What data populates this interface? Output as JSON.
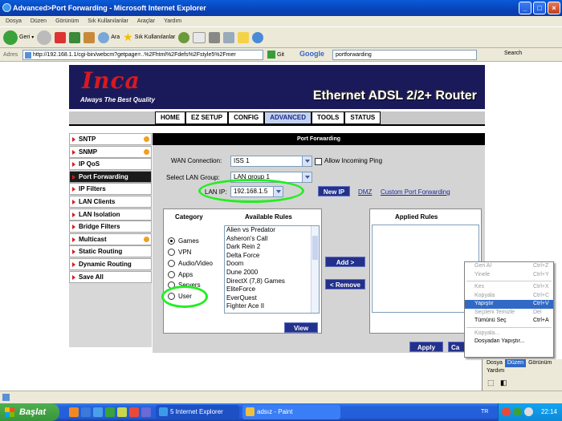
{
  "window": {
    "title": "Advanced>Port Forwarding - Microsoft Internet Explorer"
  },
  "menubar": [
    "Dosya",
    "Düzen",
    "Görünüm",
    "Sık Kullanılanlar",
    "Araçlar",
    "Yardım"
  ],
  "toolbar": {
    "back": "Geri",
    "search": "Ara",
    "favorites": "Sık Kullanılanlar"
  },
  "address": {
    "label": "Adres",
    "url": "http://192.168.1.1/cgi-bin/webcm?getpage=..%2Fhtml%2Fdefs%2Fstyle5%2Fmer",
    "go": "Git",
    "google": "Google",
    "search_value": "portforwarding",
    "search_label": "Search"
  },
  "banner": {
    "logo": "Inca",
    "tagline": "Always The Best Quality",
    "product": "Ethernet ADSL 2/2+ Router"
  },
  "nav_tabs": [
    {
      "label": "HOME",
      "active": false
    },
    {
      "label": "EZ SETUP",
      "active": false
    },
    {
      "label": "CONFIG",
      "active": false
    },
    {
      "label": "ADVANCED",
      "active": true
    },
    {
      "label": "TOOLS",
      "active": false
    },
    {
      "label": "STATUS",
      "active": false
    }
  ],
  "sidebar": [
    {
      "label": "SNTP",
      "dot": true,
      "active": false
    },
    {
      "label": "SNMP",
      "dot": true,
      "active": false
    },
    {
      "label": "IP QoS",
      "dot": false,
      "active": false
    },
    {
      "label": "Port Forwarding",
      "dot": false,
      "active": true
    },
    {
      "label": "IP Filters",
      "dot": false,
      "active": false
    },
    {
      "label": "LAN Clients",
      "dot": false,
      "active": false
    },
    {
      "label": "LAN Isolation",
      "dot": false,
      "active": false
    },
    {
      "label": "Bridge Filters",
      "dot": false,
      "active": false
    },
    {
      "label": "Multicast",
      "dot": true,
      "active": false
    },
    {
      "label": "Static Routing",
      "dot": false,
      "active": false
    },
    {
      "label": "Dynamic Routing",
      "dot": false,
      "active": false
    },
    {
      "label": "Save All",
      "dot": false,
      "active": false
    }
  ],
  "panel": {
    "title": "Port Forwarding",
    "wan_label": "WAN Connection:",
    "wan_value": "ISS 1",
    "allow_ping": "Allow Incoming Ping",
    "lan_group_label": "Select LAN Group:",
    "lan_group_value": "LAN group 1",
    "lan_ip_label": "LAN IP:",
    "lan_ip_value": "192.168.1.5",
    "new_ip": "New IP",
    "dmz": "DMZ",
    "custom": "Custom Port Forwarding",
    "category_title": "Category",
    "available_title": "Available Rules",
    "applied_title": "Applied Rules",
    "categories": [
      {
        "label": "Games",
        "checked": true
      },
      {
        "label": "VPN",
        "checked": false
      },
      {
        "label": "Audio/Video",
        "checked": false
      },
      {
        "label": "Apps",
        "checked": false
      },
      {
        "label": "Servers",
        "checked": false
      },
      {
        "label": "User",
        "checked": false
      }
    ],
    "rules": [
      "Alien vs Predator",
      "Asheron's Call",
      "Dark Rein 2",
      "Delta Force",
      "Doom",
      "Dune 2000",
      "DirectX (7,8) Games",
      "EliteForce",
      "EverQuest",
      "Fighter Ace II"
    ],
    "add": "Add >",
    "remove": "< Remove",
    "view": "View",
    "apply": "Apply",
    "cancel": "Ca"
  },
  "context_menu": [
    {
      "label": "Geri Al",
      "shortcut": "Ctrl+Z",
      "state": "disabled"
    },
    {
      "label": "Yinele",
      "shortcut": "Ctrl+Y",
      "state": "disabled"
    },
    {
      "sep": true
    },
    {
      "label": "Kes",
      "shortcut": "Ctrl+X",
      "state": "disabled"
    },
    {
      "label": "Kopyala",
      "shortcut": "Ctrl+C",
      "state": "disabled"
    },
    {
      "label": "Yapıştır",
      "shortcut": "Ctrl+V",
      "state": "selected"
    },
    {
      "label": "Seçileni Temizle",
      "shortcut": "Del",
      "state": "disabled"
    },
    {
      "label": "Tümünü Seç",
      "shortcut": "Ctrl+A",
      "state": "normal"
    },
    {
      "sep": true
    },
    {
      "label": "Kopyala...",
      "shortcut": "",
      "state": "disabled"
    },
    {
      "label": "Dosyadan Yapıştır...",
      "shortcut": "",
      "state": "normal"
    }
  ],
  "paint_menu": [
    {
      "label": "Dosya",
      "active": false
    },
    {
      "label": "Düzen",
      "active": true
    },
    {
      "label": "Görünüm",
      "active": false
    }
  ],
  "paint_menu2": "Yardım",
  "taskbar": {
    "start": "Başlat",
    "tasks": [
      "5 Internet Explorer",
      "adsız - Paint"
    ],
    "lang": "TR",
    "clock": "22:14"
  }
}
